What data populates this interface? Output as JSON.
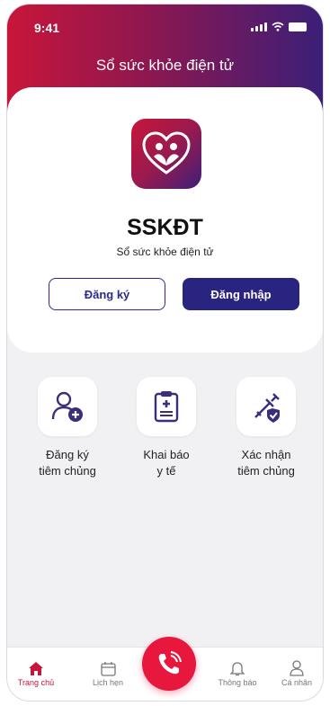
{
  "status_bar": {
    "time": "9:41"
  },
  "header": {
    "title": "Sổ sức khỏe điện tử"
  },
  "app": {
    "name": "SSKĐT",
    "subtitle": "Sổ sức khỏe điện tử"
  },
  "auth": {
    "register_label": "Đăng ký",
    "login_label": "Đăng nhập"
  },
  "actions": [
    {
      "icon": "add-user-icon",
      "line1": "Đăng ký",
      "line2": "tiêm chủng"
    },
    {
      "icon": "medical-clipboard-icon",
      "line1": "Khai báo",
      "line2": "y tế"
    },
    {
      "icon": "vaccine-shield-icon",
      "line1": "Xác nhận",
      "line2": "tiêm chủng"
    }
  ],
  "bottom_nav": [
    {
      "icon": "home-icon",
      "label": "Trang chủ",
      "active": true
    },
    {
      "icon": "calendar-icon",
      "label": "Lịch hẹn"
    },
    {
      "icon": "phone-call-icon",
      "label": ""
    },
    {
      "icon": "bell-icon",
      "label": "Thông báo"
    },
    {
      "icon": "user-icon",
      "label": "Cá nhân"
    }
  ],
  "colors": {
    "brand_red": "#c8163a",
    "brand_navy": "#29247f",
    "call_red": "#e8173e"
  }
}
